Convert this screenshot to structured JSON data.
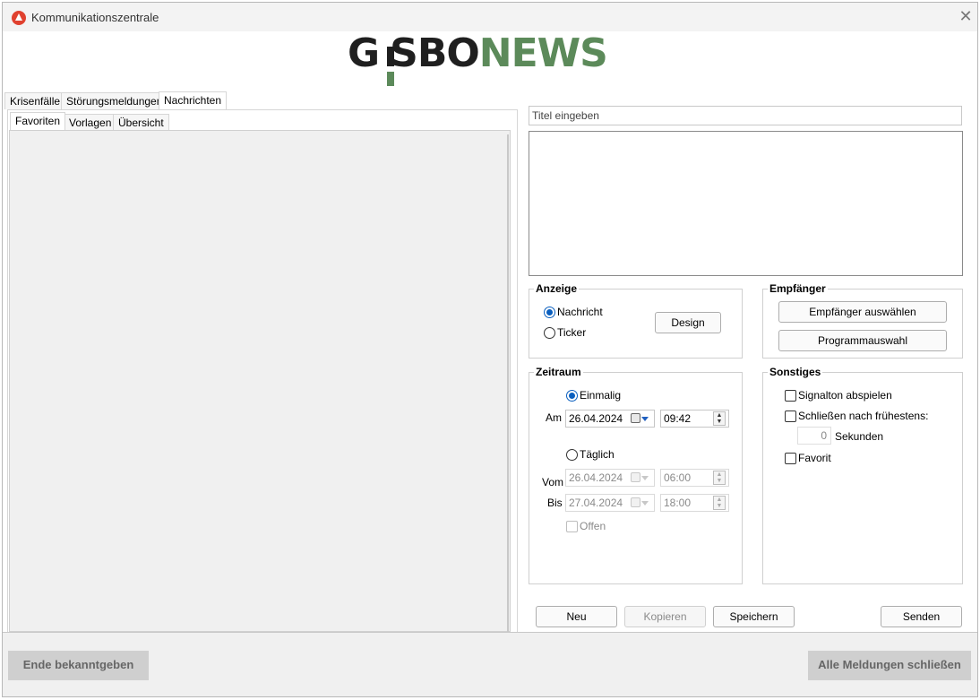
{
  "window": {
    "title": "Kommunikationszentrale",
    "close_glyph": "✕"
  },
  "logo": {
    "part1": "G",
    "part2": "SBO",
    "part3": "NEWS"
  },
  "main_tabs": [
    "Krisenfälle",
    "Störungsmeldungen",
    "Nachrichten"
  ],
  "sub_tabs": [
    "Favoriten",
    "Vorlagen",
    "Übersicht"
  ],
  "title_input": {
    "placeholder": "Titel eingeben"
  },
  "anzeige": {
    "title": "Anzeige",
    "options": [
      "Nachricht",
      "Ticker"
    ],
    "selected": "Nachricht",
    "design_button": "Design"
  },
  "empfaenger": {
    "title": "Empfänger",
    "select_button": "Empfänger auswählen",
    "program_button": "Programmauswahl"
  },
  "zeitraum": {
    "title": "Zeitraum",
    "einmalig": "Einmalig",
    "am_label": "Am",
    "am_date": "26.04.2024",
    "am_time": "09:42",
    "taeglich": "Täglich",
    "vom_label": "Vom",
    "vom_date": "26.04.2024",
    "vom_time": "06:00",
    "bis_label": "Bis",
    "bis_date": "27.04.2024",
    "bis_time": "18:00",
    "offen": "Offen",
    "selected": "Einmalig"
  },
  "sonstiges": {
    "title": "Sonstiges",
    "signalton": "Signalton abspielen",
    "schliessen": "Schließen nach frühestens:",
    "seconds_value": "0",
    "seconds_label": "Sekunden",
    "favorit": "Favorit"
  },
  "actions": {
    "neu": "Neu",
    "kopieren": "Kopieren",
    "speichern": "Speichern",
    "senden": "Senden"
  },
  "footer": {
    "ende": "Ende bekanntgeben",
    "alle": "Alle Meldungen schließen"
  },
  "colors": {
    "accent": "#0a5fbf",
    "logo_green": "#5c8a5a",
    "app_icon": "#e0412f"
  }
}
